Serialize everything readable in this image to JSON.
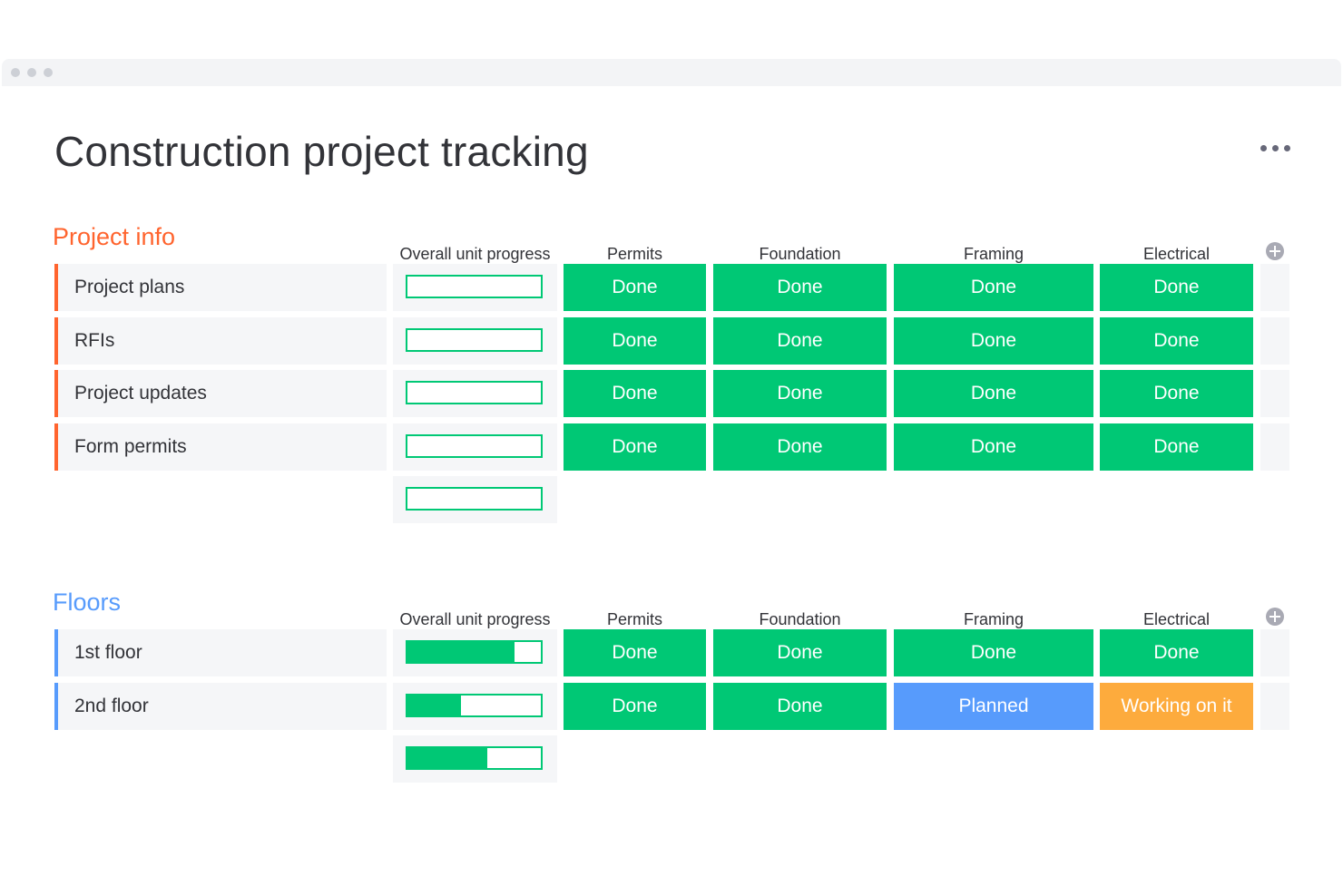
{
  "page_title": "Construction project tracking",
  "colors": {
    "done": "#00c875",
    "planned": "#579bfc",
    "working": "#fdab3d",
    "group_project_info": "#ff642e",
    "group_floors": "#579bfc"
  },
  "icons": {
    "more": "more-horizontal-icon",
    "add_column": "plus-circle-icon"
  },
  "groups": [
    {
      "title": "Project info",
      "color": "#ff642e",
      "columns": [
        "Overall unit progress",
        "Permits",
        "Foundation",
        "Framing",
        "Electrical"
      ],
      "rows": [
        {
          "name": "Project plans",
          "progress": 0,
          "statuses": [
            "Done",
            "Done",
            "Done",
            "Done"
          ]
        },
        {
          "name": "RFIs",
          "progress": 0,
          "statuses": [
            "Done",
            "Done",
            "Done",
            "Done"
          ]
        },
        {
          "name": "Project updates",
          "progress": 0,
          "statuses": [
            "Done",
            "Done",
            "Done",
            "Done"
          ]
        },
        {
          "name": "Form permits",
          "progress": 0,
          "statuses": [
            "Done",
            "Done",
            "Done",
            "Done"
          ]
        }
      ],
      "summary_progress": 0
    },
    {
      "title": "Floors",
      "color": "#579bfc",
      "columns": [
        "Overall unit progress",
        "Permits",
        "Foundation",
        "Framing",
        "Electrical"
      ],
      "rows": [
        {
          "name": "1st floor",
          "progress": 0.8,
          "statuses": [
            "Done",
            "Done",
            "Done",
            "Done"
          ]
        },
        {
          "name": "2nd floor",
          "progress": 0.4,
          "statuses": [
            "Done",
            "Done",
            "Planned",
            "Working on it"
          ]
        }
      ],
      "summary_progress": 0.6
    }
  ]
}
